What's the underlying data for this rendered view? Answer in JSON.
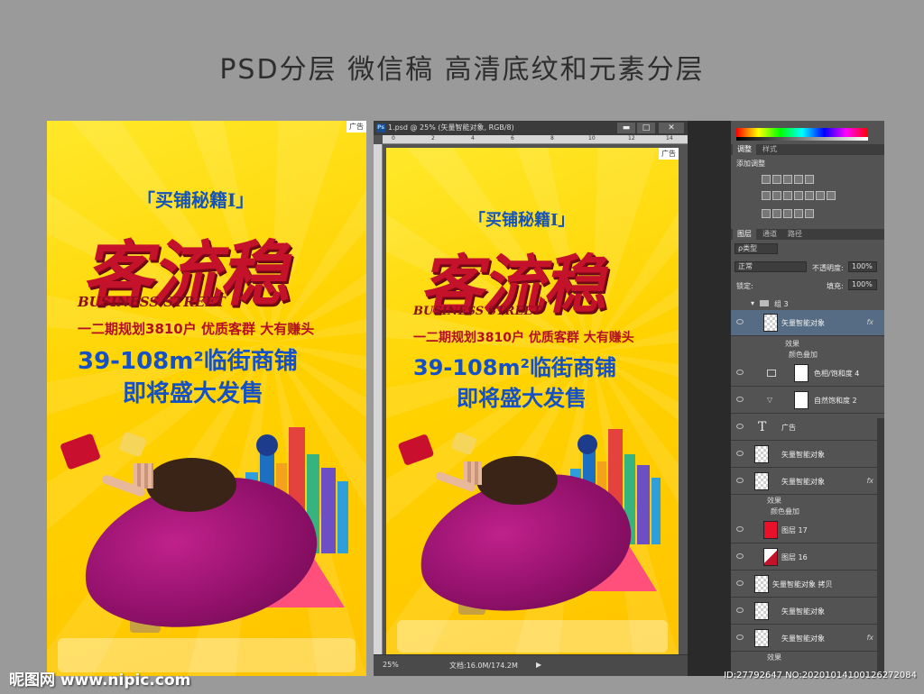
{
  "heading": "PSD分层 微信稿 高清底纹和元素分层",
  "poster": {
    "ad_tag": "广告",
    "subtitle": "「买铺秘籍Ⅰ」",
    "headline": "客流稳",
    "english": "BUSINESS STREET",
    "tagline": "一二期规划3810户  优质客群  大有赚头",
    "area": "39-108m²临街商铺",
    "sale": "即将盛大发售"
  },
  "ps": {
    "title": "1.psd @ 25% (矢量智能对象, RGB/8)",
    "logo": "Ps",
    "min_btn": "▬",
    "max_btn": "□",
    "close_btn": "✕",
    "ruler": [
      "0",
      "2",
      "4",
      "6",
      "8",
      "10",
      "12",
      "14"
    ],
    "zoom": "25%",
    "doc_info": "文档:16.0M/174.2M",
    "arrow": "▶"
  },
  "panel": {
    "tabs_top": [
      "调整",
      "样式"
    ],
    "add_adjustment": "添加调整",
    "tabs_layers": [
      "图层",
      "通道",
      "路径"
    ],
    "filter_kind": "ρ类型",
    "blend_mode": "正常",
    "opacity_label": "不透明度:",
    "opacity_value": "100%",
    "lock_label": "锁定:",
    "fill_label": "填充:",
    "fill_value": "100%",
    "group": "组 3",
    "layers": [
      {
        "name": "矢量智能对象",
        "fx": "fx",
        "effects": [
          "效果",
          "颜色叠加"
        ]
      },
      {
        "name": "色相/饱和度 4"
      },
      {
        "name": "自然饱和度 2"
      },
      {
        "name": "广告"
      },
      {
        "name": "矢量智能对象"
      },
      {
        "name": "矢量智能对象",
        "fx": "fx",
        "effects": [
          "效果",
          "颜色叠加"
        ]
      },
      {
        "name": "图层 17"
      },
      {
        "name": "图层 16"
      },
      {
        "name": "矢量智能对象 拷贝"
      },
      {
        "name": "矢量智能对象"
      },
      {
        "name": "矢量智能对象",
        "fx": "fx",
        "effects": [
          "效果"
        ]
      }
    ],
    "type_icon": "T"
  },
  "watermark": {
    "left": "昵图网 www.nipic.com",
    "right": "ID:27792647 NO:20201014100126272084"
  }
}
